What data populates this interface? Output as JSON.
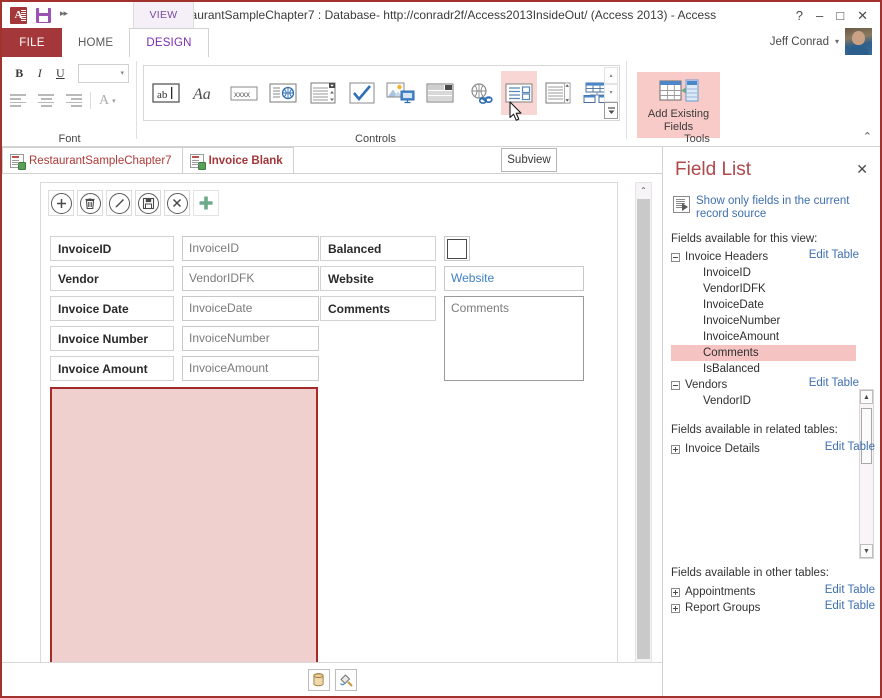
{
  "window": {
    "title": "RestaurantSampleChapter7 : Database- http://conradr2f/Access2013InsideOut/ (Access 2013) - Access",
    "help_icon": "?",
    "minimize_icon": "–",
    "maximize_icon": "□",
    "close_icon": "✕",
    "logo_letter": "A"
  },
  "quick_access": {
    "save_label": "Save",
    "more_label": "▸▸"
  },
  "contextual": {
    "view_tab_label": "VIEW"
  },
  "ribbon": {
    "tabs": [
      {
        "label": "FILE",
        "active": false
      },
      {
        "label": "HOME",
        "active": false
      },
      {
        "label": "DESIGN",
        "active": true
      }
    ],
    "account": {
      "name": "Jeff Conrad",
      "caret": "▾"
    },
    "groups": [
      {
        "label": "Font"
      },
      {
        "label": "Controls"
      },
      {
        "label": "Tools"
      }
    ],
    "font_group": {
      "bold": "B",
      "italic": "I",
      "underline": "U",
      "font_size_value": "",
      "dropdown_caret": "▾",
      "align_left": "align-left",
      "align_center": "align-center",
      "align_right": "align-right",
      "font_color": "A",
      "font_color_caret": "▾"
    },
    "controls_gallery": [
      {
        "name": "text-box-control",
        "glyph": "ab|"
      },
      {
        "name": "label-control",
        "glyph": "Aa"
      },
      {
        "name": "unbound-control",
        "glyph": "xxxx"
      },
      {
        "name": "hyperlink-box-control",
        "glyph": "globe-in-box"
      },
      {
        "name": "combo-box-control",
        "glyph": "combo"
      },
      {
        "name": "check-box-control",
        "glyph": "✓"
      },
      {
        "name": "image-control",
        "glyph": "image"
      },
      {
        "name": "web-browser-control",
        "glyph": "browser"
      },
      {
        "name": "hyperlink-control",
        "glyph": "globe-link"
      },
      {
        "name": "subview-control",
        "glyph": "subview",
        "selected": true
      },
      {
        "name": "list-box-control",
        "glyph": "listbox"
      },
      {
        "name": "related-items-control",
        "glyph": "related-items"
      }
    ],
    "gallery_scroll": {
      "up": "▴",
      "down": "▾",
      "more": "▾"
    },
    "tools": {
      "add_existing_fields_line1": "Add Existing",
      "add_existing_fields_line2": "Fields"
    },
    "collapse_icon": "⌃"
  },
  "document_tabs": {
    "tabs": [
      {
        "label": "RestaurantSampleChapter7",
        "active": false
      },
      {
        "label": "Invoice Blank",
        "active": true
      }
    ],
    "tooltip": "Subview",
    "close_icon": "✕"
  },
  "form": {
    "action_bar": [
      {
        "name": "add-record-button",
        "glyph": "+"
      },
      {
        "name": "delete-record-button",
        "glyph": "trash"
      },
      {
        "name": "edit-record-button",
        "glyph": "pencil"
      },
      {
        "name": "save-record-button",
        "glyph": "save"
      },
      {
        "name": "cancel-edits-button",
        "glyph": "✕"
      },
      {
        "name": "add-action-button",
        "glyph": "+"
      }
    ],
    "fields_left": [
      {
        "label": "InvoiceID",
        "value": "InvoiceID"
      },
      {
        "label": "Vendor",
        "value": "VendorIDFK"
      },
      {
        "label": "Invoice Date",
        "value": "InvoiceDate"
      },
      {
        "label": "Invoice Number",
        "value": "InvoiceNumber"
      },
      {
        "label": "Invoice Amount",
        "value": "InvoiceAmount"
      }
    ],
    "fields_right": [
      {
        "label": "Balanced",
        "value": "",
        "type": "checkbox"
      },
      {
        "label": "Website",
        "value": "Website",
        "type": "hyperlink"
      },
      {
        "label": "Comments",
        "value": "Comments",
        "type": "multiline"
      }
    ],
    "placeholder_region": {
      "name": "subview-placeholder",
      "fill_color": "#f0cfcf",
      "border_color": "#a42a2a"
    },
    "status_buttons": [
      {
        "name": "data-source-button",
        "glyph": "database"
      },
      {
        "name": "formatting-button",
        "glyph": "paint"
      }
    ],
    "scrollbar": {
      "up": "⌃",
      "down": "⌄"
    }
  },
  "field_list": {
    "title": "Field List",
    "close_icon": "✕",
    "show_only_link_line1": "Show only fields in the current",
    "show_only_link_line2": "record source",
    "section_this_view": "Fields available for this view:",
    "section_related": "Fields available in related tables:",
    "section_other": "Fields available in other tables:",
    "edit_table_label": "Edit Table",
    "this_view_tables": [
      {
        "name": "Invoice Headers",
        "expanded": true,
        "edit_table": "Edit Table",
        "fields": [
          {
            "name": "InvoiceID",
            "selected": false
          },
          {
            "name": "VendorIDFK",
            "selected": false
          },
          {
            "name": "InvoiceDate",
            "selected": false
          },
          {
            "name": "InvoiceNumber",
            "selected": false
          },
          {
            "name": "InvoiceAmount",
            "selected": false
          },
          {
            "name": "Comments",
            "selected": true
          },
          {
            "name": "IsBalanced",
            "selected": false
          }
        ]
      },
      {
        "name": "Vendors",
        "expanded": true,
        "edit_table": "Edit Table",
        "fields": [
          {
            "name": "VendorID",
            "selected": false
          }
        ]
      }
    ],
    "related_tables": [
      {
        "name": "Invoice Details",
        "expanded": false,
        "edit_table": "Edit Table"
      }
    ],
    "other_tables": [
      {
        "name": "Appointments",
        "expanded": false,
        "edit_table": "Edit Table"
      },
      {
        "name": "Report Groups",
        "expanded": false,
        "edit_table": "Edit Table"
      }
    ],
    "scrollbar": {
      "up": "▲",
      "down": "▼"
    }
  },
  "colors": {
    "accent_red": "#a4373a",
    "window_border": "#a1322e",
    "selection_pink": "#f8cbc9",
    "link_blue": "#3f6fb0",
    "purple_tab": "#7a2bb0"
  }
}
